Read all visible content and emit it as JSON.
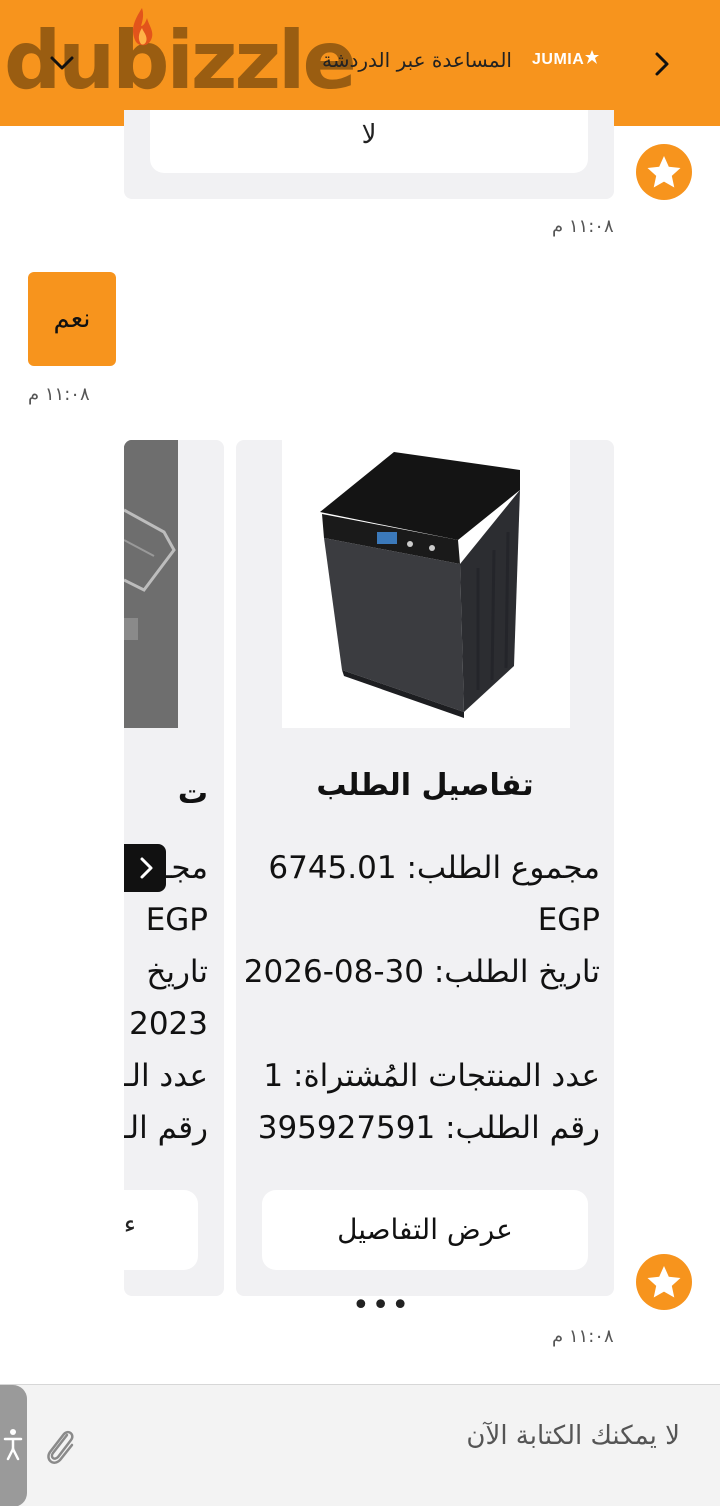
{
  "header": {
    "logo_text": "dubizzle",
    "title": "المساعدة عبر الدردشة",
    "partner_logo": "JUMIA",
    "back_icon": "chevron-right-icon",
    "collapse_icon": "chevron-down-icon",
    "background_color": "#f7941d"
  },
  "chat": {
    "previous_reply_option": "لا",
    "previous_timestamp": "١١:٠٨ م",
    "user_message": "نعم",
    "user_timestamp": "١١:٠٨ م",
    "bot_timestamp": "١١:٠٨ م",
    "bot_avatar_icon": "star-icon"
  },
  "orders_carousel": {
    "cards": [
      {
        "title": "تفاصيل الطلب",
        "total": "مجموع الطلب: 6745.01 EGP",
        "date": "تاريخ الطلب: 30-08-2026",
        "items_count": "عدد المنتجات المُشتراة: 1",
        "order_number": "رقم الطلب: 395927591",
        "button_label": "عرض التفاصيل",
        "image": "washing-machine-image"
      },
      {
        "title_partial": "ت",
        "line1": "مجـ",
        "line2": "EGP",
        "line3": "تاريخ",
        "line4": "2023",
        "line5": "عدد الـ",
        "line6": "رقم الـ",
        "button_partial": "ء",
        "image": "product-image"
      }
    ],
    "dots": "•••",
    "prev_arrow_icon": "chevron-left-icon"
  },
  "input": {
    "placeholder": "لا يمكنك الكتابة الآن",
    "attach_icon": "paperclip-icon",
    "accessibility_icon": "accessibility-icon"
  }
}
